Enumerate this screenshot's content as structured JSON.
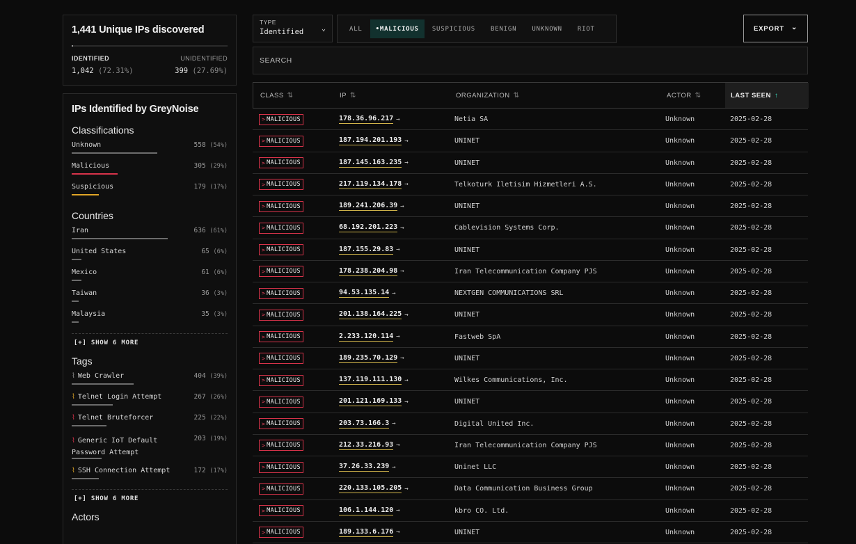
{
  "summary": {
    "title": "1,441 Unique IPs discovered",
    "identified_label": "IDENTIFIED",
    "unidentified_label": "UNIDENTIFIED",
    "identified_value": "1,042",
    "identified_pct": "(72.31%)",
    "unidentified_value": "399",
    "unidentified_pct": "(27.69%)"
  },
  "identified_panel": {
    "title": "IPs Identified by GreyNoise",
    "classifications_title": "Classifications",
    "classifications": [
      {
        "name": "Unknown",
        "count": "558",
        "pct": "(54%)",
        "share": 0.54,
        "color": "#6c6c6c"
      },
      {
        "name": "Malicious",
        "count": "305",
        "pct": "(29%)",
        "share": 0.29,
        "color": "#d8334a"
      },
      {
        "name": "Suspicious",
        "count": "179",
        "pct": "(17%)",
        "share": 0.17,
        "color": "#e0a526"
      }
    ],
    "countries_title": "Countries",
    "countries": [
      {
        "name": "Iran",
        "count": "636",
        "pct": "(61%)",
        "share": 0.61
      },
      {
        "name": "United States",
        "count": "65",
        "pct": "(6%)",
        "share": 0.06
      },
      {
        "name": "Mexico",
        "count": "61",
        "pct": "(6%)",
        "share": 0.06
      },
      {
        "name": "Taiwan",
        "count": "36",
        "pct": "(3%)",
        "share": 0.03
      },
      {
        "name": "Malaysia",
        "count": "35",
        "pct": "(3%)",
        "share": 0.03
      }
    ],
    "countries_show_more": "[+] SHOW 6 MORE",
    "tags_title": "Tags",
    "tags": [
      {
        "name": "Web Crawler",
        "count": "404",
        "pct": "(39%)",
        "share": 0.39,
        "icon_color": "#9a9a9a"
      },
      {
        "name": "Telnet Login Attempt",
        "count": "267",
        "pct": "(26%)",
        "share": 0.26,
        "icon_color": "#e0a526"
      },
      {
        "name": "Telnet Bruteforcer",
        "count": "225",
        "pct": "(22%)",
        "share": 0.22,
        "icon_color": "#d8334a"
      },
      {
        "name": "Generic IoT Default Password Attempt",
        "count": "203",
        "pct": "(19%)",
        "share": 0.19,
        "icon_color": "#d8334a"
      },
      {
        "name": "SSH Connection Attempt",
        "count": "172",
        "pct": "(17%)",
        "share": 0.17,
        "icon_color": "#e0a526"
      }
    ],
    "tags_show_more": "[+] SHOW 6 MORE",
    "actors_title": "Actors"
  },
  "type_select": {
    "label": "TYPE",
    "value": "Identified"
  },
  "filters": [
    "ALL",
    "•MALICIOUS",
    "SUSPICIOUS",
    "BENIGN",
    "UNKNOWN",
    "RIOT"
  ],
  "active_filter": "•MALICIOUS",
  "export_label": "EXPORT",
  "search_placeholder": "SEARCH",
  "table": {
    "headers": [
      "CLASS",
      "IP",
      "ORGANIZATION",
      "ACTOR",
      "LAST SEEN"
    ],
    "sorted_column": "LAST SEEN",
    "rows": [
      {
        "class": "MALICIOUS",
        "ip": "178.36.96.217",
        "org": "Netia SA",
        "actor": "Unknown",
        "last_seen": "2025-02-28"
      },
      {
        "class": "MALICIOUS",
        "ip": "187.194.201.193",
        "org": "UNINET",
        "actor": "Unknown",
        "last_seen": "2025-02-28"
      },
      {
        "class": "MALICIOUS",
        "ip": "187.145.163.235",
        "org": "UNINET",
        "actor": "Unknown",
        "last_seen": "2025-02-28"
      },
      {
        "class": "MALICIOUS",
        "ip": "217.119.134.178",
        "org": "Telkoturk Iletisim Hizmetleri A.S.",
        "actor": "Unknown",
        "last_seen": "2025-02-28"
      },
      {
        "class": "MALICIOUS",
        "ip": "189.241.206.39",
        "org": "UNINET",
        "actor": "Unknown",
        "last_seen": "2025-02-28"
      },
      {
        "class": "MALICIOUS",
        "ip": "68.192.201.223",
        "org": "Cablevision Systems Corp.",
        "actor": "Unknown",
        "last_seen": "2025-02-28"
      },
      {
        "class": "MALICIOUS",
        "ip": "187.155.29.83",
        "org": "UNINET",
        "actor": "Unknown",
        "last_seen": "2025-02-28"
      },
      {
        "class": "MALICIOUS",
        "ip": "178.238.204.98",
        "org": "Iran Telecommunication Company PJS",
        "actor": "Unknown",
        "last_seen": "2025-02-28"
      },
      {
        "class": "MALICIOUS",
        "ip": "94.53.135.14",
        "org": "NEXTGEN COMMUNICATIONS SRL",
        "actor": "Unknown",
        "last_seen": "2025-02-28"
      },
      {
        "class": "MALICIOUS",
        "ip": "201.138.164.225",
        "org": "UNINET",
        "actor": "Unknown",
        "last_seen": "2025-02-28"
      },
      {
        "class": "MALICIOUS",
        "ip": "2.233.120.114",
        "org": "Fastweb SpA",
        "actor": "Unknown",
        "last_seen": "2025-02-28"
      },
      {
        "class": "MALICIOUS",
        "ip": "189.235.70.129",
        "org": "UNINET",
        "actor": "Unknown",
        "last_seen": "2025-02-28"
      },
      {
        "class": "MALICIOUS",
        "ip": "137.119.111.130",
        "org": "Wilkes Communications, Inc.",
        "actor": "Unknown",
        "last_seen": "2025-02-28"
      },
      {
        "class": "MALICIOUS",
        "ip": "201.121.169.133",
        "org": "UNINET",
        "actor": "Unknown",
        "last_seen": "2025-02-28"
      },
      {
        "class": "MALICIOUS",
        "ip": "203.73.166.3",
        "org": "Digital United Inc.",
        "actor": "Unknown",
        "last_seen": "2025-02-28"
      },
      {
        "class": "MALICIOUS",
        "ip": "212.33.216.93",
        "org": "Iran Telecommunication Company PJS",
        "actor": "Unknown",
        "last_seen": "2025-02-28"
      },
      {
        "class": "MALICIOUS",
        "ip": "37.26.33.239",
        "org": "Uninet LLC",
        "actor": "Unknown",
        "last_seen": "2025-02-28"
      },
      {
        "class": "MALICIOUS",
        "ip": "220.133.105.205",
        "org": "Data Communication Business Group",
        "actor": "Unknown",
        "last_seen": "2025-02-28"
      },
      {
        "class": "MALICIOUS",
        "ip": "106.1.144.120",
        "org": "kbro CO. Ltd.",
        "actor": "Unknown",
        "last_seen": "2025-02-28"
      },
      {
        "class": "MALICIOUS",
        "ip": "189.133.6.176",
        "org": "UNINET",
        "actor": "Unknown",
        "last_seen": "2025-02-28"
      }
    ]
  }
}
